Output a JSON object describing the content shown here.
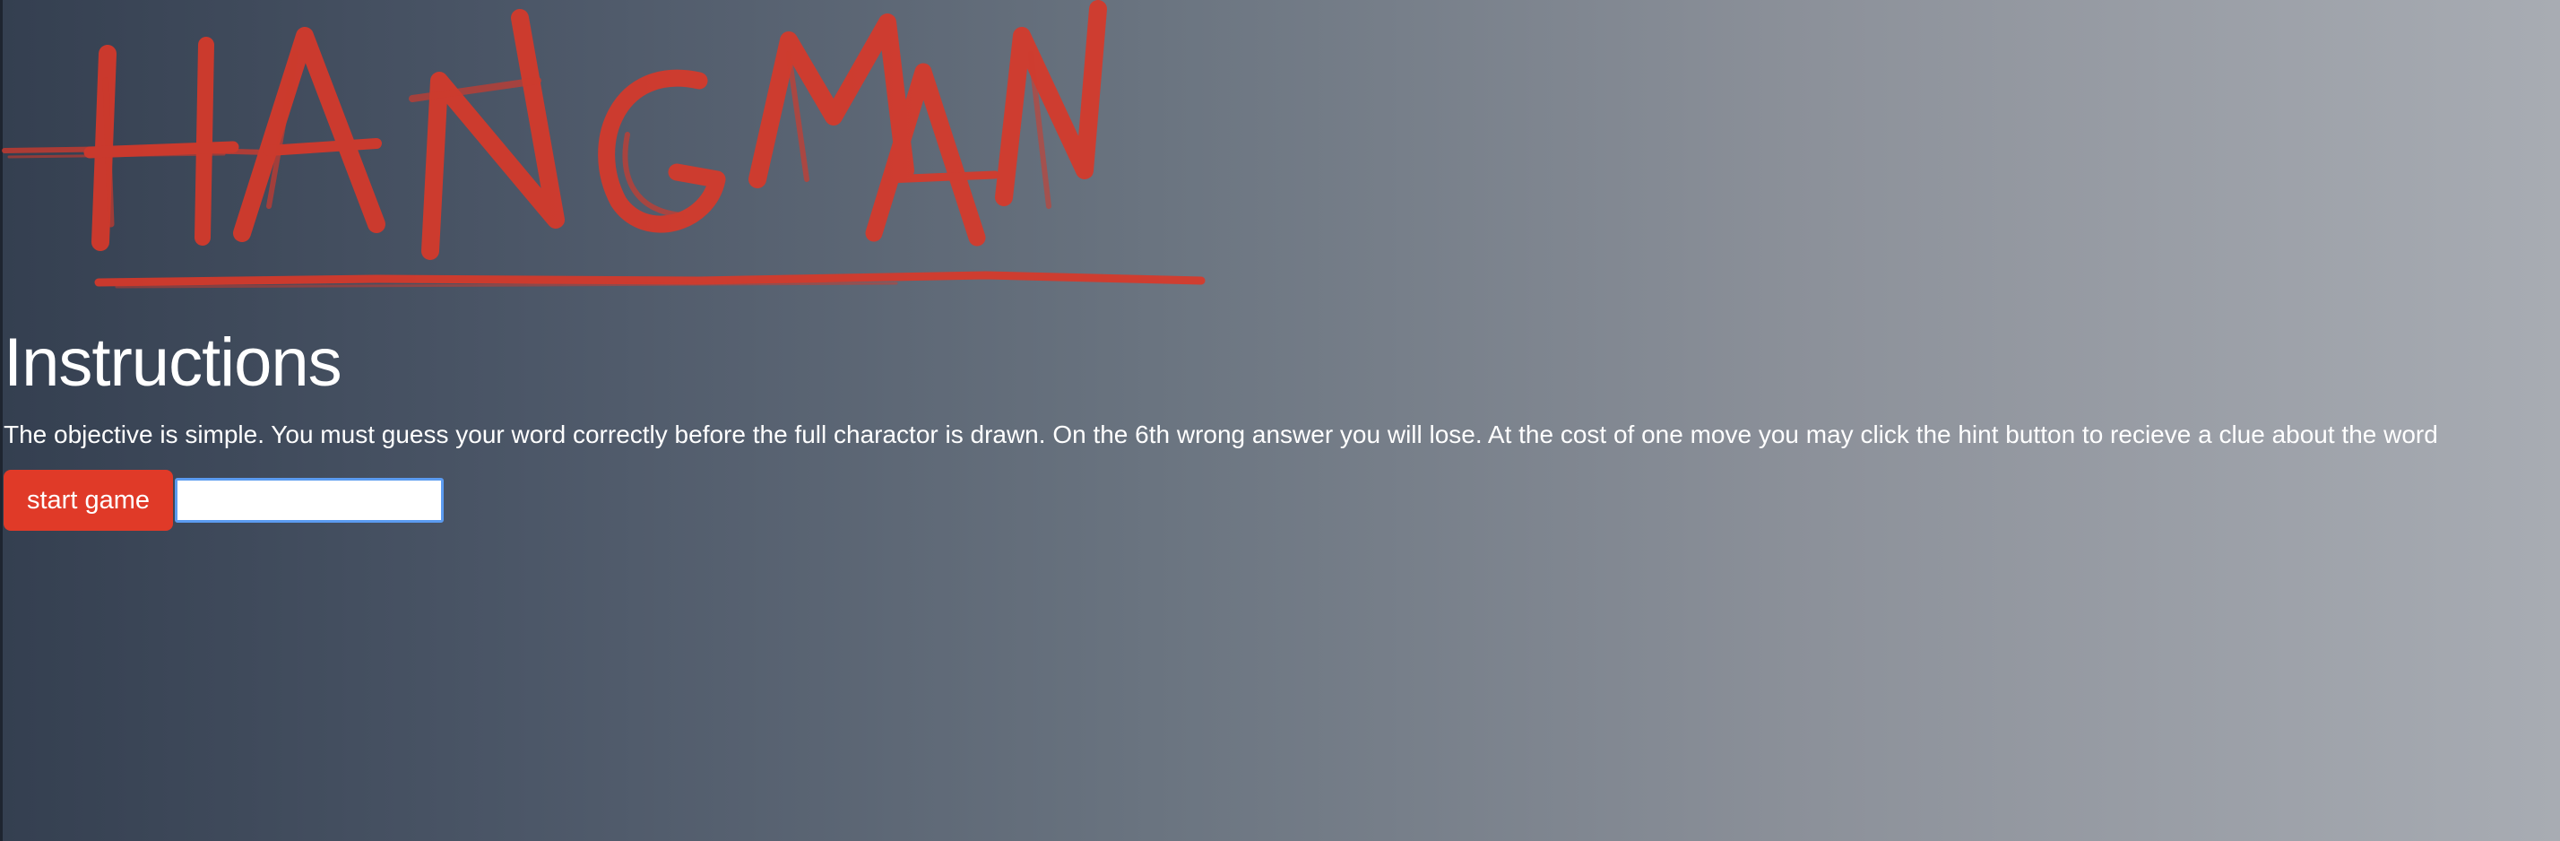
{
  "logo": {
    "text": "HANGMAN",
    "color": "#d8392a"
  },
  "instructions": {
    "title": "Instructions",
    "text": "The objective is simple. You must guess your word correctly before the full charactor is drawn. On the 6th wrong answer you will lose. At the cost of one move you may click the hint button to recieve a clue about the word"
  },
  "controls": {
    "start_label": "start game",
    "input_value": "",
    "accent": "#e03a28",
    "input_focus_color": "#5b9bf0"
  }
}
